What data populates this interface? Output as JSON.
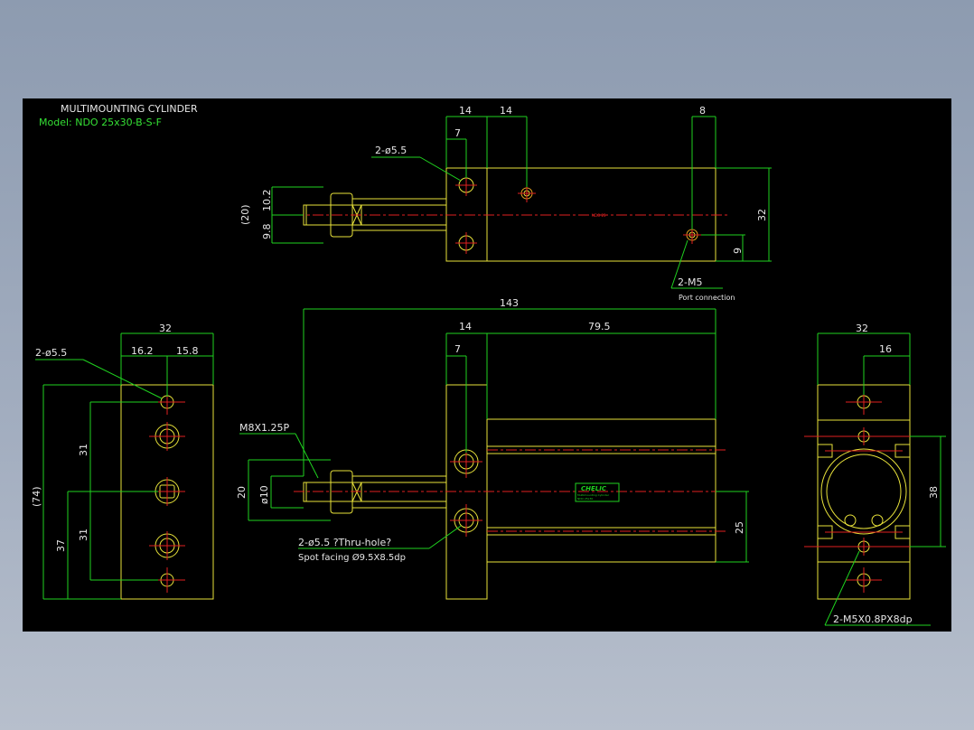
{
  "title": {
    "line1": "MULTIMOUNTING CYLINDER",
    "line2": "Model: NDO 25x30-B-S-F"
  },
  "top_view": {
    "dim_14a": "14",
    "dim_14b": "14",
    "dim_7": "7",
    "dim_8": "8",
    "dim_20": "(20)",
    "dim_102": "10.2",
    "dim_98": "9.8",
    "dim_32": "32",
    "dim_9": "9",
    "hole_label": "2-ø5.5",
    "port_label": "2-M5",
    "port_desc": "Port connection",
    "body_marking": "NDO 25"
  },
  "left_view": {
    "dim_32": "32",
    "dim_162": "16.2",
    "dim_158": "15.8",
    "hole_label": "2-ø5.5",
    "dim_74": "(74)",
    "dim_31a": "31",
    "dim_31b": "31",
    "dim_37": "37"
  },
  "front_view": {
    "dim_143": "143",
    "dim_14": "14",
    "dim_795": "79.5",
    "dim_7": "7",
    "thread_label": "M8X1.25P",
    "dim_20": "20",
    "dim_phi10": "ø10",
    "hole_label": "2-ø5.5 ?Thru-hole?",
    "spot_label": "Spot facing  Ø9.5X8.5dp",
    "dim_25": "25",
    "nameplate_brand": "CHELIC",
    "nameplate_line1": "Multimounting Cylinder",
    "nameplate_line2": "NDO 25x30"
  },
  "right_view": {
    "dim_32": "32",
    "dim_16": "16",
    "dim_38": "38",
    "thread_label": "2-M5X0.8PX8dp"
  },
  "colors": {
    "background": "#000000",
    "outline": "#e8e23a",
    "dimension": "#1fd21f",
    "centerline": "#e02020",
    "text": "#e6e6e6"
  }
}
